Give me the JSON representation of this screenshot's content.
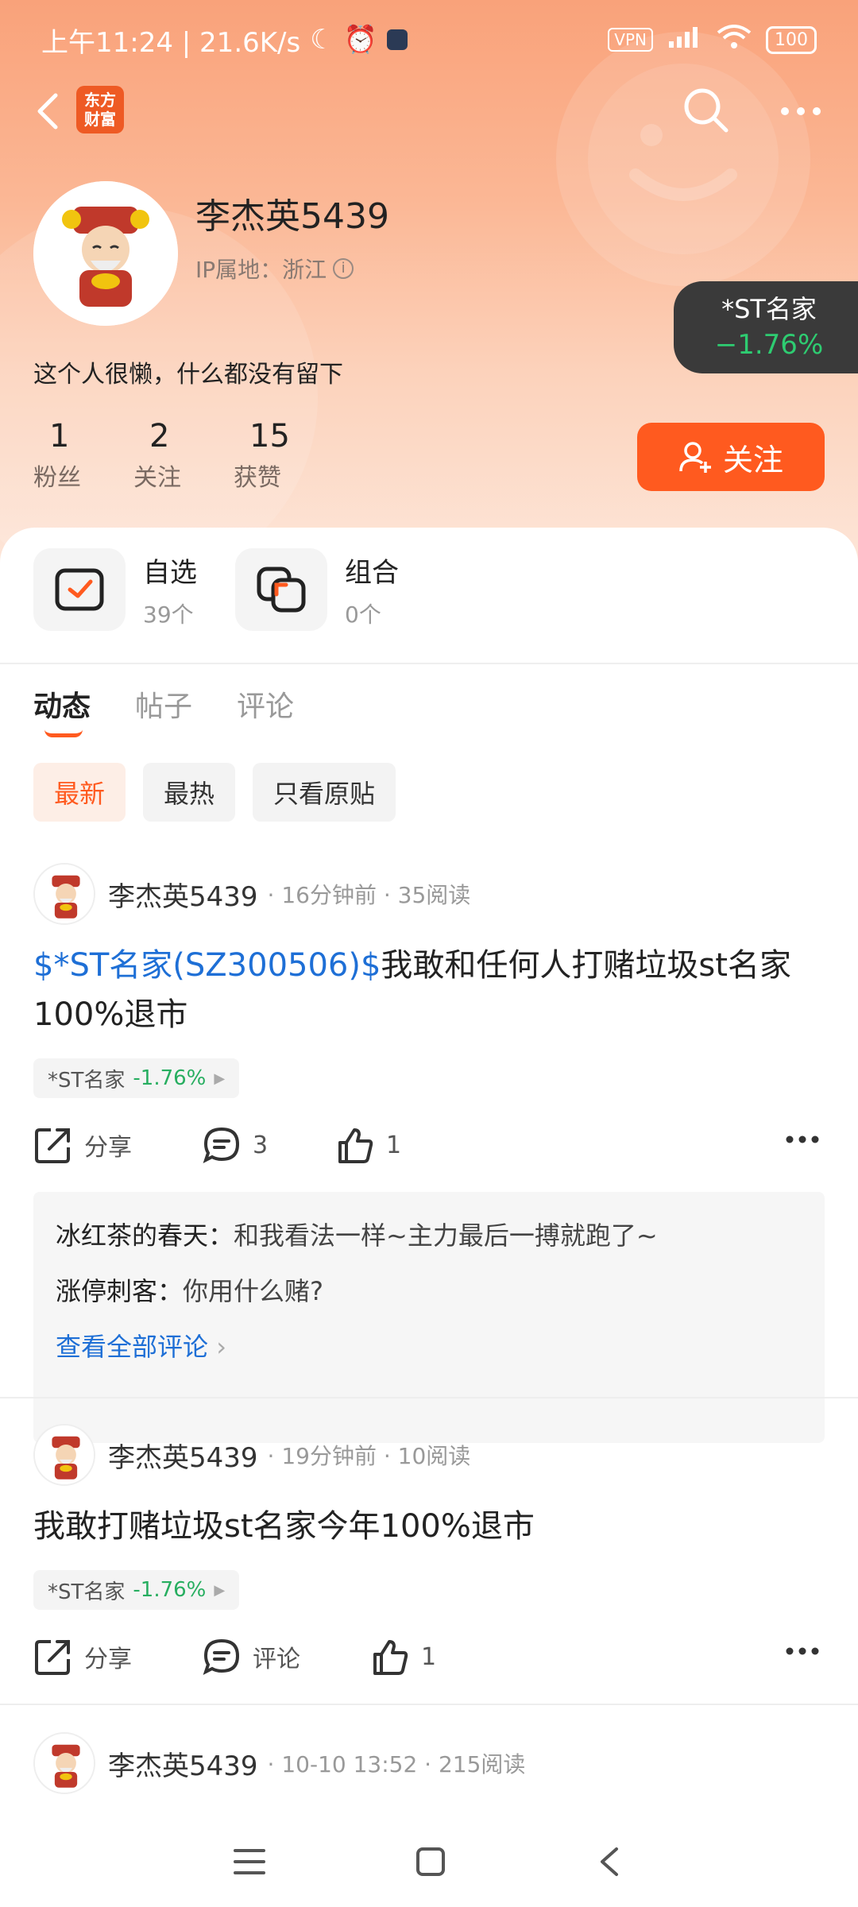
{
  "status_bar": {
    "time_speed": "上午11:24 | 21.6K/s",
    "vpn": "VPN",
    "battery": "100"
  },
  "app": {
    "logo_text": "东方财富"
  },
  "profile": {
    "name": "李杰英5439",
    "ip_location": "IP属地：浙江",
    "bio": "这个人很懒，什么都没有留下",
    "stats": [
      {
        "value": "1",
        "label": "粉丝"
      },
      {
        "value": "2",
        "label": "关注"
      },
      {
        "value": "15",
        "label": "获赞"
      }
    ],
    "follow_label": "关注"
  },
  "floating_stock": {
    "name": "*ST名家",
    "change": "−1.76%"
  },
  "quick_links": [
    {
      "title": "自选",
      "count": "39个"
    },
    {
      "title": "组合",
      "count": "0个"
    }
  ],
  "tabs": [
    "动态",
    "帖子",
    "评论"
  ],
  "filters": [
    "最新",
    "最热",
    "只看原贴"
  ],
  "posts": [
    {
      "author": "李杰英5439",
      "meta": "· 16分钟前 · 35阅读",
      "tag": "$*ST名家(SZ300506)$",
      "text": "我敢和任何人打赌垃圾st名家100%退市",
      "stock_name": "*ST名家",
      "stock_change": "-1.76%",
      "share": "分享",
      "comments": "3",
      "likes": "1",
      "comment_list": [
        {
          "who": "冰红茶的春天：",
          "text": "和我看法一样~主力最后一搏就跑了~"
        },
        {
          "who": "涨停刺客：",
          "text": "你用什么赌?"
        }
      ],
      "see_all": "查看全部评论"
    },
    {
      "author": "李杰英5439",
      "meta": "· 19分钟前 · 10阅读",
      "text": "我敢打赌垃圾st名家今年100%退市",
      "stock_name": "*ST名家",
      "stock_change": "-1.76%",
      "share": "分享",
      "comments": "评论",
      "likes": "1"
    },
    {
      "author": "李杰英5439",
      "meta": "· 10-10 13:52 · 215阅读"
    }
  ],
  "colors": {
    "accent": "#ff5a1f",
    "down": "#27ae60",
    "link": "#1e6fd6"
  }
}
